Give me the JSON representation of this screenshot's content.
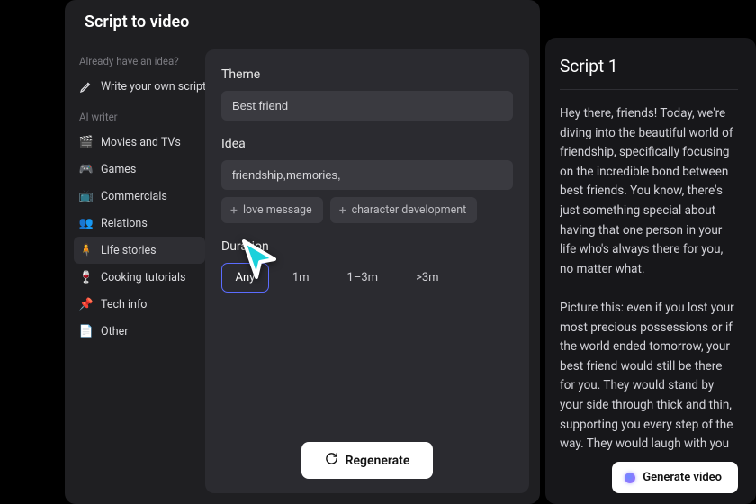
{
  "header": {
    "title": "Script to video"
  },
  "sidebar": {
    "prompt_heading": "Already have an idea?",
    "write_own": "Write your own script",
    "ai_heading": "AI writer",
    "categories": [
      {
        "icon": "🎬",
        "label": "Movies and TVs"
      },
      {
        "icon": "🎮",
        "label": "Games"
      },
      {
        "icon": "📺",
        "label": "Commercials"
      },
      {
        "icon": "👥",
        "label": "Relations"
      },
      {
        "icon": "🧍",
        "label": "Life stories"
      },
      {
        "icon": "🍷",
        "label": "Cooking tutorials"
      },
      {
        "icon": "📌",
        "label": "Tech info"
      },
      {
        "icon": "📄",
        "label": "Other"
      }
    ],
    "active_index": 4
  },
  "form": {
    "theme_label": "Theme",
    "theme_value": "Best friend",
    "idea_label": "Idea",
    "idea_value": "friendship,memories,",
    "suggestions": [
      "love message",
      "character development"
    ],
    "duration_label": "Duration",
    "durations": [
      "Any",
      "1m",
      "1–3m",
      ">3m"
    ],
    "duration_selected": 0,
    "regenerate_label": "Regenerate"
  },
  "script": {
    "title": "Script 1",
    "body": "Hey there, friends! Today, we're diving into the beautiful world of friendship, specifically focusing on the incredible bond between best friends. You know, there's just something special about having that one person in your life who's always there for you, no matter what.\n\nPicture this: even if you lost your most precious possessions or if the world ended tomorrow, your best friend would still be there for you. They would stand by your side through thick and thin, supporting you every step of the way. They would laugh with you in the sunshine and cry with you in the rain because they genuinely care about you and want the best for you…",
    "generate_label": "Generate video"
  }
}
